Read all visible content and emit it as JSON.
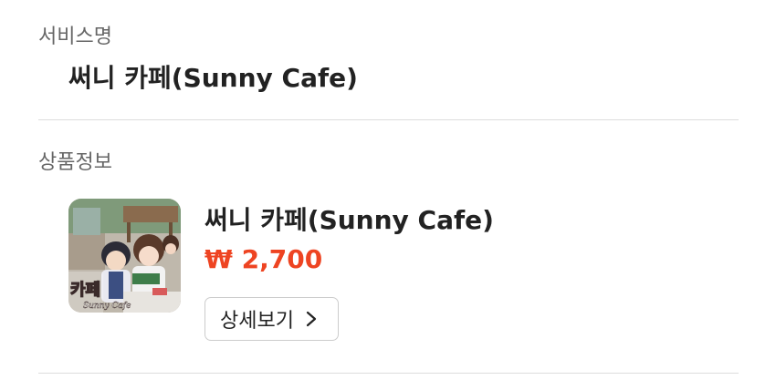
{
  "service": {
    "label": "서비스명",
    "name": "써니 카페(Sunny Cafe)"
  },
  "product": {
    "label": "상품정보",
    "title": "써니 카페(Sunny Cafe)",
    "price": "₩ 2,700",
    "price_color": "#ee4422",
    "detail_button_label": "상세보기",
    "thumbnail_text": "카페",
    "thumbnail_subtext": "Sunny Cafe"
  }
}
